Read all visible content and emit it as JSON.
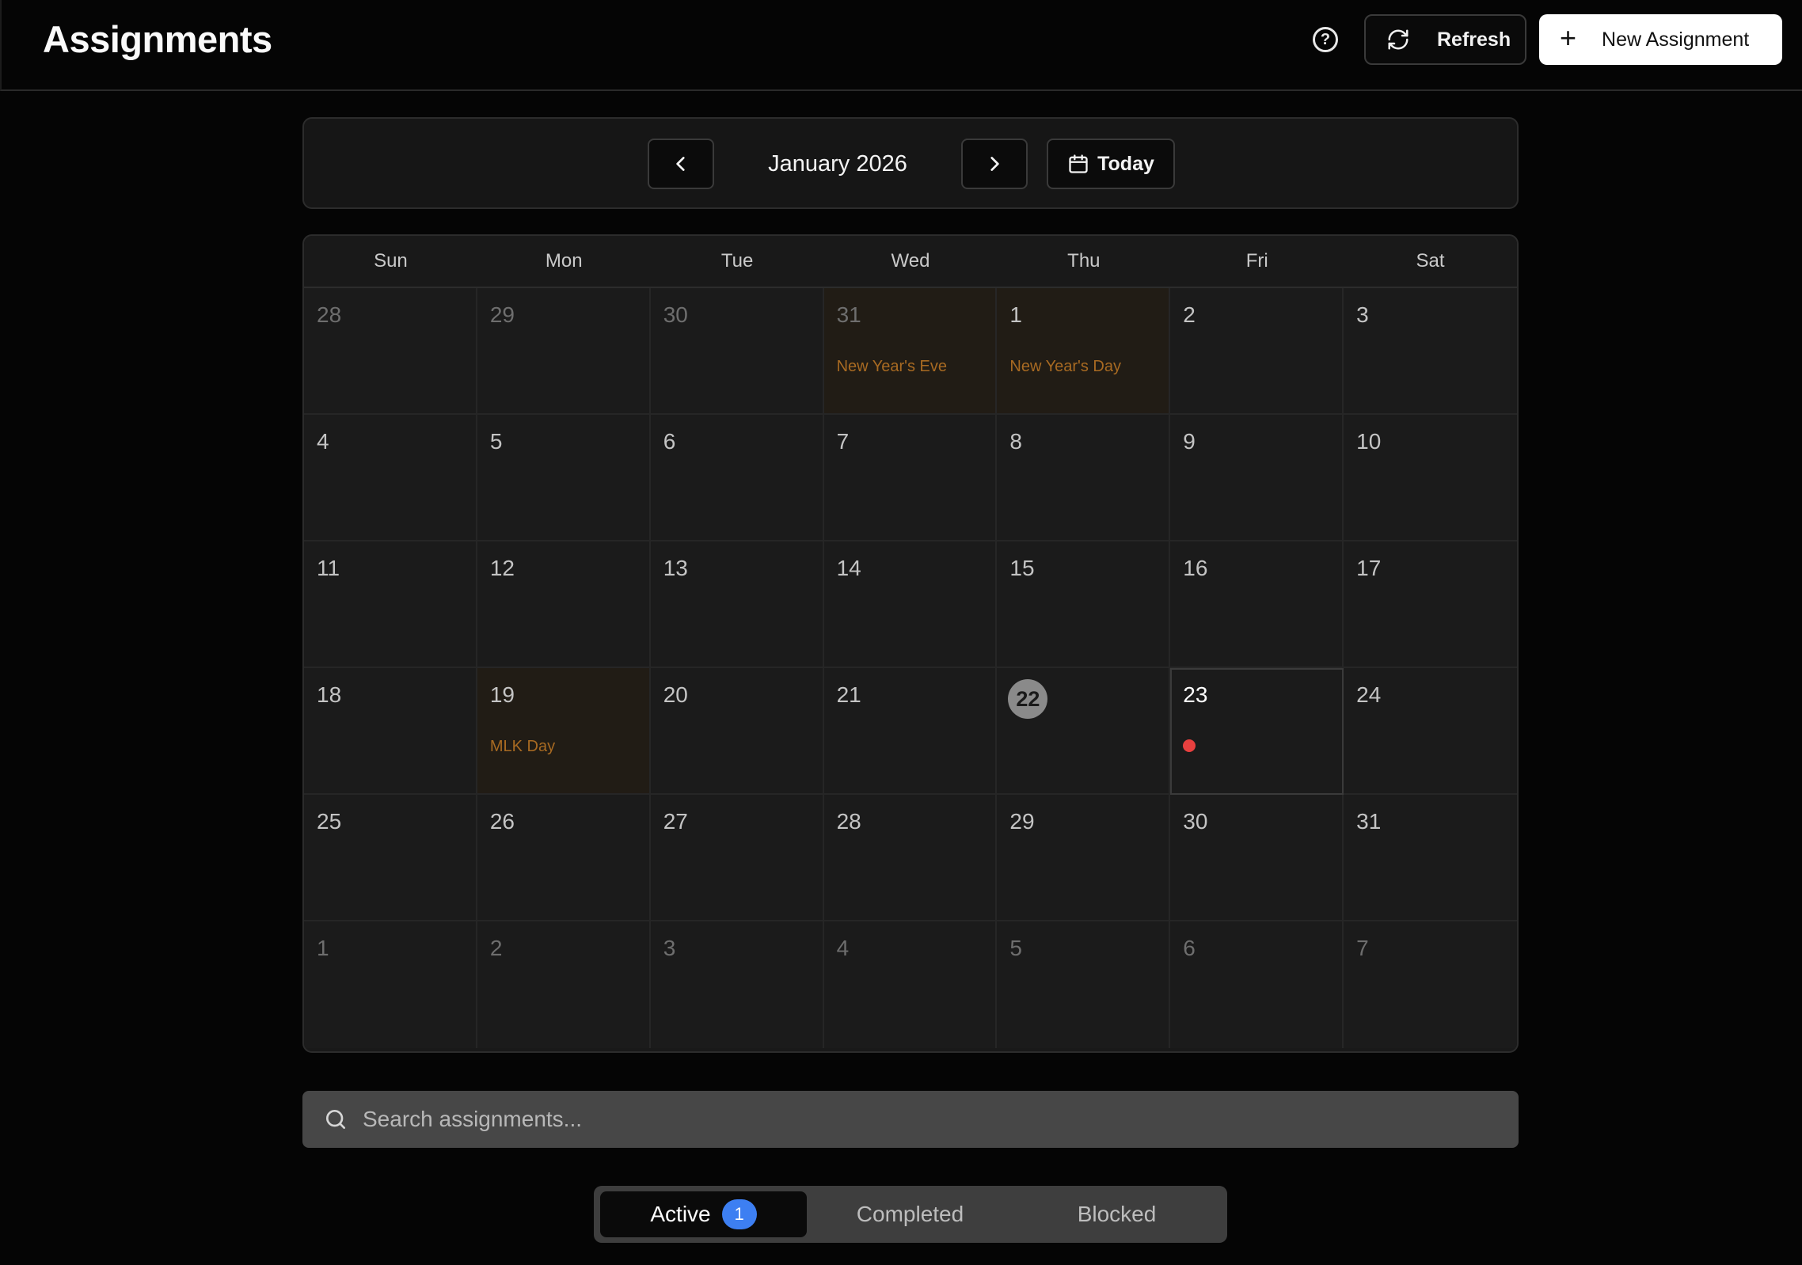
{
  "header": {
    "title": "Assignments",
    "help_glyph": "?",
    "refresh_label": "Refresh",
    "new_label": "New Assignment",
    "new_glyph": "+"
  },
  "month_nav": {
    "label": "January 2026",
    "today_label": "Today"
  },
  "calendar": {
    "weekdays": [
      "Sun",
      "Mon",
      "Tue",
      "Wed",
      "Thu",
      "Fri",
      "Sat"
    ],
    "days": [
      {
        "num": "28",
        "other": true
      },
      {
        "num": "29",
        "other": true
      },
      {
        "num": "30",
        "other": true
      },
      {
        "num": "31",
        "other": true,
        "holiday": "New Year's Eve"
      },
      {
        "num": "1",
        "holiday": "New Year's Day"
      },
      {
        "num": "2"
      },
      {
        "num": "3"
      },
      {
        "num": "4"
      },
      {
        "num": "5"
      },
      {
        "num": "6"
      },
      {
        "num": "7"
      },
      {
        "num": "8"
      },
      {
        "num": "9"
      },
      {
        "num": "10"
      },
      {
        "num": "11"
      },
      {
        "num": "12"
      },
      {
        "num": "13"
      },
      {
        "num": "14"
      },
      {
        "num": "15"
      },
      {
        "num": "16"
      },
      {
        "num": "17"
      },
      {
        "num": "18"
      },
      {
        "num": "19",
        "holiday": "MLK Day"
      },
      {
        "num": "20"
      },
      {
        "num": "21"
      },
      {
        "num": "22",
        "today": true
      },
      {
        "num": "23",
        "selected": true,
        "has_assignment": true
      },
      {
        "num": "24"
      },
      {
        "num": "25"
      },
      {
        "num": "26"
      },
      {
        "num": "27"
      },
      {
        "num": "28"
      },
      {
        "num": "29"
      },
      {
        "num": "30"
      },
      {
        "num": "31"
      },
      {
        "num": "1",
        "other": true
      },
      {
        "num": "2",
        "other": true
      },
      {
        "num": "3",
        "other": true
      },
      {
        "num": "4",
        "other": true
      },
      {
        "num": "5",
        "other": true
      },
      {
        "num": "6",
        "other": true
      },
      {
        "num": "7",
        "other": true
      }
    ]
  },
  "search": {
    "placeholder": "Search assignments..."
  },
  "tabs": {
    "active_label": "Active",
    "active_count": "1",
    "completed_label": "Completed",
    "blocked_label": "Blocked"
  },
  "colors": {
    "holiday_text": "#a86a22",
    "assignment_dot": "#e8403f",
    "badge_blue": "#3d7ff2"
  }
}
